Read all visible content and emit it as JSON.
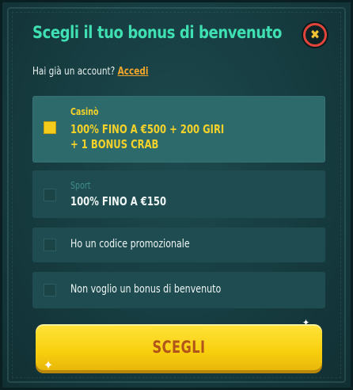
{
  "modal": {
    "title": "Scegli il tuo bonus di benvenuto",
    "close_icon": "close-icon",
    "login_prompt": "Hai già un account?",
    "login_link": "Accedi"
  },
  "options": [
    {
      "category": "Casinò",
      "line1": "100% FINO A €500 + 200 GIRI",
      "line2": "+ 1 BONUS CRAB",
      "selected": true
    },
    {
      "category": "Sport",
      "line1": "100% FINO A €150",
      "selected": false
    },
    {
      "label": "Ho un codice promozionale",
      "selected": false
    },
    {
      "label": "Non voglio un bonus di benvenuto",
      "selected": false
    }
  ],
  "cta": {
    "label": "SCEGLI"
  },
  "colors": {
    "title": "#3fe0b2",
    "accent_yellow": "#f4d22a",
    "link_orange": "#f0a62a",
    "close_red": "#e0443a",
    "panel": "#163c40",
    "selected_row": "#2d6a6c"
  }
}
